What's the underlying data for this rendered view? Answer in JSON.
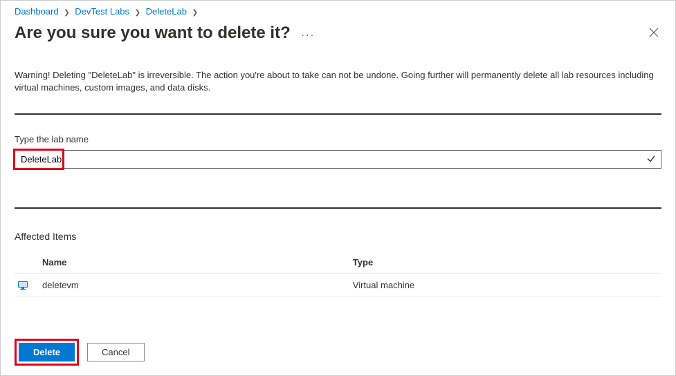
{
  "breadcrumb": {
    "items": [
      {
        "label": "Dashboard"
      },
      {
        "label": "DevTest Labs"
      },
      {
        "label": "DeleteLab"
      }
    ]
  },
  "header": {
    "title": "Are you sure you want to delete it?"
  },
  "warning": {
    "text": "Warning! Deleting \"DeleteLab\" is irreversible. The action you're about to take can not be undone. Going further will permanently delete all lab resources including virtual machines, custom images, and data disks."
  },
  "lab_field": {
    "label": "Type the lab name",
    "value": "DeleteLab"
  },
  "affected": {
    "title": "Affected Items",
    "columns": {
      "name": "Name",
      "type": "Type"
    },
    "rows": [
      {
        "name": "deletevm",
        "type": "Virtual machine"
      }
    ]
  },
  "buttons": {
    "delete": "Delete",
    "cancel": "Cancel"
  }
}
